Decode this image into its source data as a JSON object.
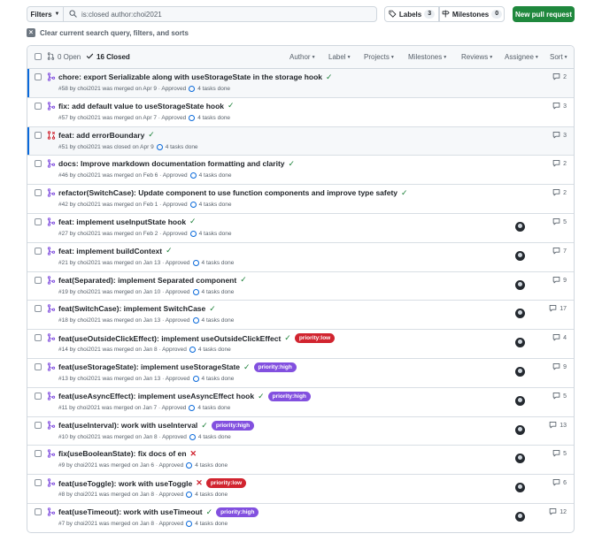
{
  "toolbar": {
    "filters_label": "Filters",
    "search_value": "is:closed author:choi2021",
    "labels_label": "Labels",
    "labels_count": "3",
    "milestones_label": "Milestones",
    "milestones_count": "0",
    "new_pr_label": "New pull request"
  },
  "clear_query_label": "Clear current search query, filters, and sorts",
  "header": {
    "open_label": "0 Open",
    "closed_label": "16 Closed",
    "filters": [
      "Author",
      "Label",
      "Projects",
      "Milestones",
      "Reviews",
      "Assignee",
      "Sort"
    ]
  },
  "colors": {
    "merged": "#8250df",
    "closed": "#cf222e",
    "approved_check": "#1a7f37",
    "priority_low": "#d1242f",
    "priority_high": "#8250df",
    "new_pr": "#1f883d"
  },
  "pull_requests": [
    {
      "title": "chore: export Serializable along with useStorageState in the storage hook",
      "status_icon": "check",
      "label": "",
      "label_color": "",
      "meta": "#58 by choi2021 was merged on Apr 9 · Approved",
      "tasks": "4 tasks done",
      "comments": "2",
      "avatar": false,
      "state": "merged"
    },
    {
      "title": "fix: add default value to useStorageState hook",
      "status_icon": "check",
      "label": "",
      "label_color": "",
      "meta": "#57 by choi2021 was merged on Apr 7 · Approved",
      "tasks": "4 tasks done",
      "comments": "3",
      "avatar": false,
      "state": "merged"
    },
    {
      "title": "feat: add errorBoundary",
      "status_icon": "check",
      "label": "",
      "label_color": "",
      "meta": "#51 by choi2021 was closed on Apr 9",
      "tasks": "4 tasks done",
      "comments": "3",
      "avatar": false,
      "state": "closed"
    },
    {
      "title": "docs: Improve markdown documentation formatting and clarity",
      "status_icon": "check",
      "label": "",
      "label_color": "",
      "meta": "#46 by choi2021 was merged on Feb 6 · Approved",
      "tasks": "4 tasks done",
      "comments": "2",
      "avatar": false,
      "state": "merged"
    },
    {
      "title": "refactor(SwitchCase): Update component to use function components and improve type safety",
      "status_icon": "check",
      "label": "",
      "label_color": "",
      "meta": "#42 by choi2021 was merged on Feb 1 · Approved",
      "tasks": "4 tasks done",
      "comments": "2",
      "avatar": false,
      "state": "merged"
    },
    {
      "title": "feat: implement useInputState hook",
      "status_icon": "check",
      "label": "",
      "label_color": "",
      "meta": "#27 by choi2021 was merged on Feb 2 · Approved",
      "tasks": "4 tasks done",
      "comments": "5",
      "avatar": true,
      "state": "merged"
    },
    {
      "title": "feat: implement buildContext",
      "status_icon": "check",
      "label": "",
      "label_color": "",
      "meta": "#21 by choi2021 was merged on Jan 13 · Approved",
      "tasks": "4 tasks done",
      "comments": "7",
      "avatar": true,
      "state": "merged"
    },
    {
      "title": "feat(Separated): implement Separated component",
      "status_icon": "check",
      "label": "",
      "label_color": "",
      "meta": "#19 by choi2021 was merged on Jan 10 · Approved",
      "tasks": "4 tasks done",
      "comments": "9",
      "avatar": true,
      "state": "merged"
    },
    {
      "title": "feat(SwitchCase): implement SwitchCase",
      "status_icon": "check",
      "label": "",
      "label_color": "",
      "meta": "#18 by choi2021 was merged on Jan 13 · Approved",
      "tasks": "4 tasks done",
      "comments": "17",
      "avatar": true,
      "state": "merged"
    },
    {
      "title": "feat(useOutsideClickEffect): implement useOutsideClickEffect",
      "status_icon": "check",
      "label": "priority:low",
      "label_color": "#d1242f",
      "meta": "#14 by choi2021 was merged on Jan 8 · Approved",
      "tasks": "4 tasks done",
      "comments": "4",
      "avatar": true,
      "state": "merged"
    },
    {
      "title": "feat(useStorageState): implement useStorageState",
      "status_icon": "check",
      "label": "priority:high",
      "label_color": "#8250df",
      "meta": "#13 by choi2021 was merged on Jan 13 · Approved",
      "tasks": "4 tasks done",
      "comments": "9",
      "avatar": true,
      "state": "merged"
    },
    {
      "title": "feat(useAsyncEffect): implement useAsyncEffect hook",
      "status_icon": "check",
      "label": "priority:high",
      "label_color": "#8250df",
      "meta": "#11 by choi2021 was merged on Jan 7 · Approved",
      "tasks": "4 tasks done",
      "comments": "5",
      "avatar": true,
      "state": "merged"
    },
    {
      "title": "feat(useInterval): work with useInterval",
      "status_icon": "check",
      "label": "priority:high",
      "label_color": "#8250df",
      "meta": "#10 by choi2021 was merged on Jan 8 · Approved",
      "tasks": "4 tasks done",
      "comments": "13",
      "avatar": true,
      "state": "merged"
    },
    {
      "title": "fix(useBooleanState): fix docs of en",
      "status_icon": "x",
      "label": "",
      "label_color": "",
      "meta": "#9 by choi2021 was merged on Jan 6 · Approved",
      "tasks": "4 tasks done",
      "comments": "5",
      "avatar": true,
      "state": "merged"
    },
    {
      "title": "feat(useToggle): work with useToggle",
      "status_icon": "x",
      "label": "priority:low",
      "label_color": "#d1242f",
      "meta": "#8 by choi2021 was merged on Jan 8 · Approved",
      "tasks": "4 tasks done",
      "comments": "6",
      "avatar": true,
      "state": "merged"
    },
    {
      "title": "feat(useTimeout): work with useTimeout",
      "status_icon": "check",
      "label": "priority:high",
      "label_color": "#8250df",
      "meta": "#7 by choi2021 was merged on Jan 8 · Approved",
      "tasks": "4 tasks done",
      "comments": "12",
      "avatar": true,
      "state": "merged"
    }
  ]
}
